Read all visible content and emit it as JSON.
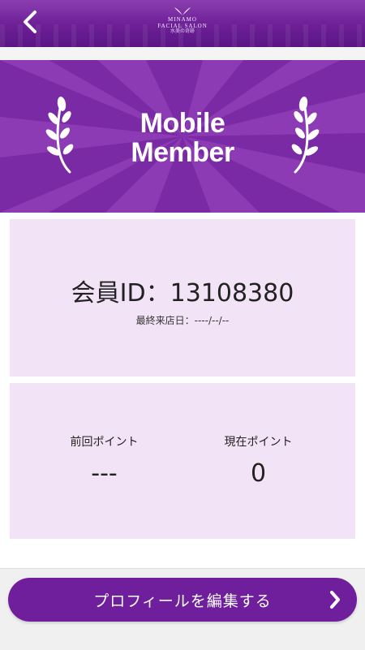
{
  "header": {
    "back_icon": "chevron-left-icon",
    "logo": {
      "line1": "MINAMO",
      "line2": "FACIAL SALON",
      "line3": "水美の奇跡"
    }
  },
  "banner": {
    "title_line1": "Mobile",
    "title_line2": "Member",
    "left_icon": "laurel-icon",
    "right_icon": "laurel-icon",
    "background_color": "#7b2aa5"
  },
  "member_card": {
    "member_id_text": "会員ID：13108380",
    "last_visit_text": "最終来店日：----/--/--"
  },
  "points_card": {
    "previous_label": "前回ポイント",
    "previous_value": "---",
    "current_label": "現在ポイント",
    "current_value": "0"
  },
  "footer": {
    "edit_profile_label": "プロフィールを編集する",
    "chevron_icon": "chevron-right-icon",
    "button_color": "#6f1f9c"
  }
}
